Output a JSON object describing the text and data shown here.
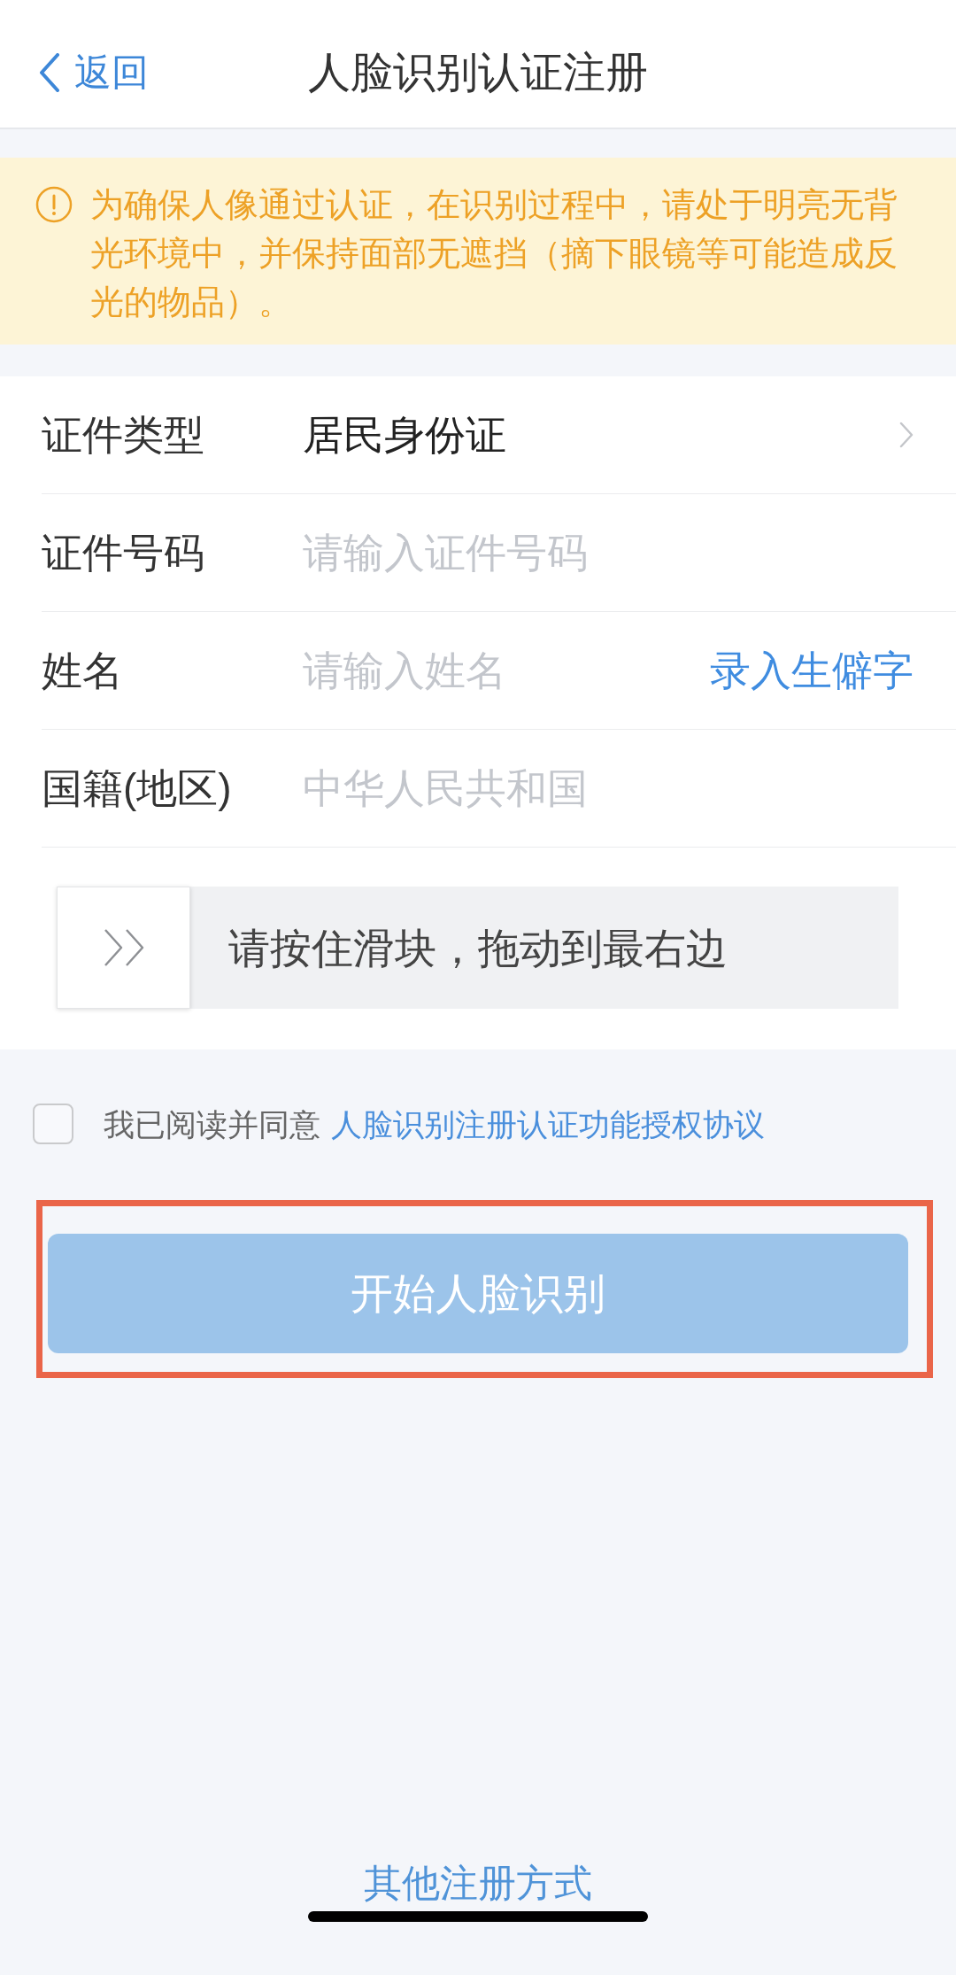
{
  "header": {
    "back": {
      "label": "返回"
    },
    "title": "人脸识别认证注册"
  },
  "notice": {
    "text": "为确保人像通过认证，在识别过程中，请处于明亮无背光环境中，并保持面部无遮挡（摘下眼镜等可能造成反光的物品）。"
  },
  "form": {
    "fields": [
      {
        "kind": "select",
        "label": "证件类型",
        "value": "居民身份证"
      },
      {
        "kind": "input",
        "label": "证件号码",
        "placeholder": "请输入证件号码"
      },
      {
        "kind": "input",
        "label": "姓名",
        "placeholder": "请输入姓名",
        "action": "录入生僻字"
      },
      {
        "kind": "input",
        "label": "国籍(地区)",
        "placeholder": "中华人民共和国"
      }
    ]
  },
  "slider": {
    "label": "请按住滑块，拖动到最右边",
    "level": 0
  },
  "agreement": {
    "checked": false,
    "text": "我已阅读并同意",
    "link": "人脸识别注册认证功能授权协议"
  },
  "start_button": {
    "label": "开始人脸识别",
    "disabled": true,
    "highlighted": true
  },
  "other_link": "其他注册方式"
}
